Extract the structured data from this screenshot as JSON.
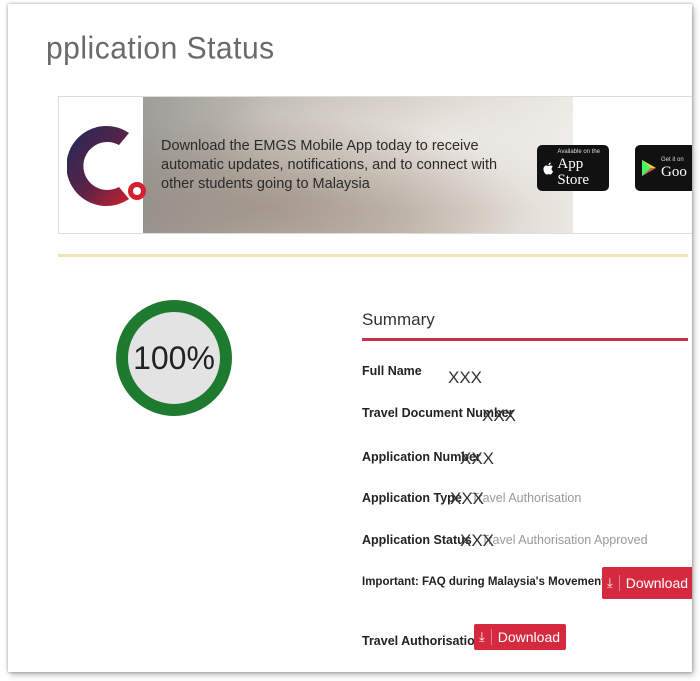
{
  "page": {
    "title": "pplication Status"
  },
  "banner": {
    "text": "Download the EMGS Mobile App today to receive automatic updates, notifications, and to connect with other students going to Malaysia",
    "app_store": {
      "small": "Available on the",
      "big": "App Store",
      "icon": "apple-icon"
    },
    "google_play": {
      "small": "Get it on",
      "big": "Goo",
      "icon": "play-icon"
    }
  },
  "progress": {
    "value": 100,
    "label": "100%",
    "color": "#1e7a2f",
    "track_color": "#e3e3e3"
  },
  "summary": {
    "title": "Summary",
    "accent": "#c8314e",
    "full_name": {
      "label": "Full Name",
      "value": "XXX"
    },
    "travel_document_number": {
      "label": "Travel Document Number",
      "value": "XXX"
    },
    "application_number": {
      "label": "Application Number",
      "value": "XXX"
    },
    "application_type": {
      "label": "Application Type",
      "value": "Travel Authorisation",
      "mask": "XXX"
    },
    "application_status": {
      "label": "Application Status",
      "value": "Travel Authorisation Approved",
      "mask": "XXX"
    },
    "faq": {
      "label": "Important: FAQ during Malaysia's Movement Control Order",
      "button": "Download"
    },
    "letter": {
      "label": "Travel Authorisation Letter",
      "button": "Download"
    }
  }
}
